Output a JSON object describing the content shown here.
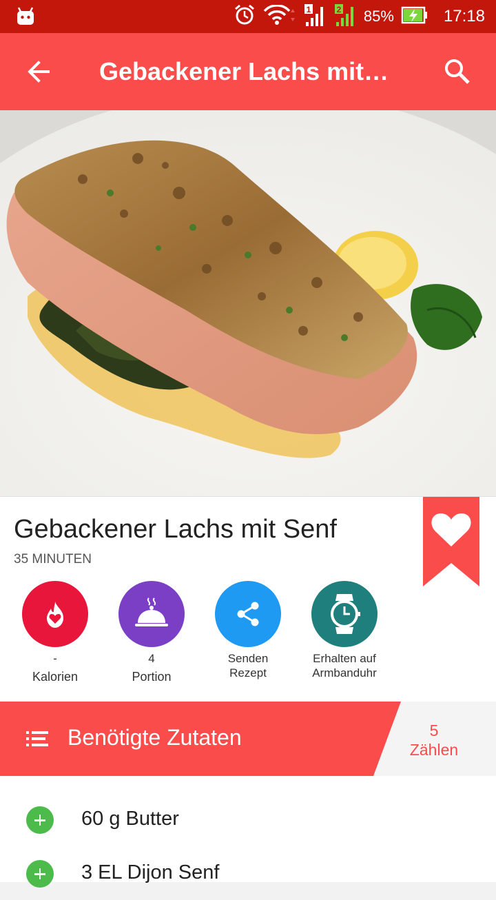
{
  "status_bar": {
    "battery": "85%",
    "time": "17:18",
    "sim1": "1",
    "sim2": "2"
  },
  "app_bar": {
    "title": "Gebackener Lachs mit…",
    "back_icon": "arrow-back-icon",
    "search_icon": "search-icon"
  },
  "recipe": {
    "title": "Gebackener Lachs mit Senf",
    "time": "35 MINUTEN",
    "favorite_icon": "heart-bookmark-icon"
  },
  "actions": [
    {
      "value": "-",
      "label": "Kalorien",
      "icon": "flame-heart-icon",
      "color": "#e8163a"
    },
    {
      "value": "4",
      "label": "Portion",
      "icon": "cloche-icon",
      "color": "#7b3fc6"
    },
    {
      "label": "Senden Rezept",
      "line1": "Senden",
      "line2": "Rezept",
      "icon": "share-icon",
      "color": "#1e9af3"
    },
    {
      "label": "Erhalten auf Armbanduhr",
      "line1": "Erhalten auf",
      "line2": "Armbanduhr",
      "icon": "watch-icon",
      "color": "#1e7f7c"
    }
  ],
  "ingredients_header": {
    "title": "Benötigte Zutaten",
    "count": "5",
    "count_label": "Zählen",
    "menu_icon": "list-icon"
  },
  "ingredients": [
    {
      "text": "60 g Butter",
      "icon": "add-circle-icon"
    },
    {
      "text": "3 EL Dijon Senf",
      "icon": "add-circle-icon"
    }
  ],
  "colors": {
    "status_bar": "#c4170c",
    "app_bar": "#fb4c4c",
    "accent": "#fb4c4c",
    "add_green": "#4cbb4c"
  }
}
